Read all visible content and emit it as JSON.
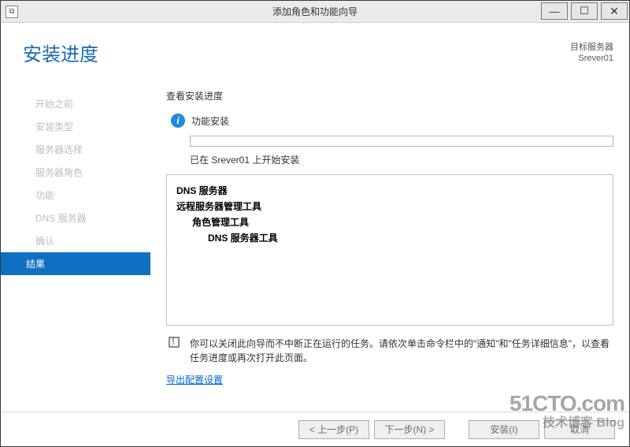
{
  "window": {
    "title": "添加角色和功能向导",
    "icon_label": "☐"
  },
  "header": {
    "page_title": "安装进度",
    "target_label": "目标服务器",
    "target_name": "Srever01"
  },
  "sidebar": {
    "steps": [
      {
        "label": "开始之前"
      },
      {
        "label": "安装类型"
      },
      {
        "label": "服务器选择"
      },
      {
        "label": "服务器角色"
      },
      {
        "label": "功能"
      },
      {
        "label": "DNS 服务器"
      },
      {
        "label": "确认"
      },
      {
        "label": "结果",
        "active": true
      }
    ]
  },
  "content": {
    "view_label": "查看安装进度",
    "status_text": "功能安装",
    "progress_msg": "已在 Srever01 上开始安装",
    "features": [
      {
        "text": "DNS 服务器",
        "level": 0
      },
      {
        "text": "远程服务器管理工具",
        "level": 0
      },
      {
        "text": "角色管理工具",
        "level": 1
      },
      {
        "text": "DNS 服务器工具",
        "level": 2
      }
    ],
    "note": "你可以关闭此向导而不中断正在运行的任务。请依次单击命令栏中的\"通知\"和\"任务详细信息\"，以查看任务进度或再次打开此页面。",
    "export_link": "导出配置设置"
  },
  "footer": {
    "prev": "< 上一步(P)",
    "next": "下一步(N) >",
    "install": "安装(I)",
    "cancel": "取消"
  },
  "watermark": {
    "main": "51CTO.com",
    "sub": "技术博客 Blog"
  }
}
